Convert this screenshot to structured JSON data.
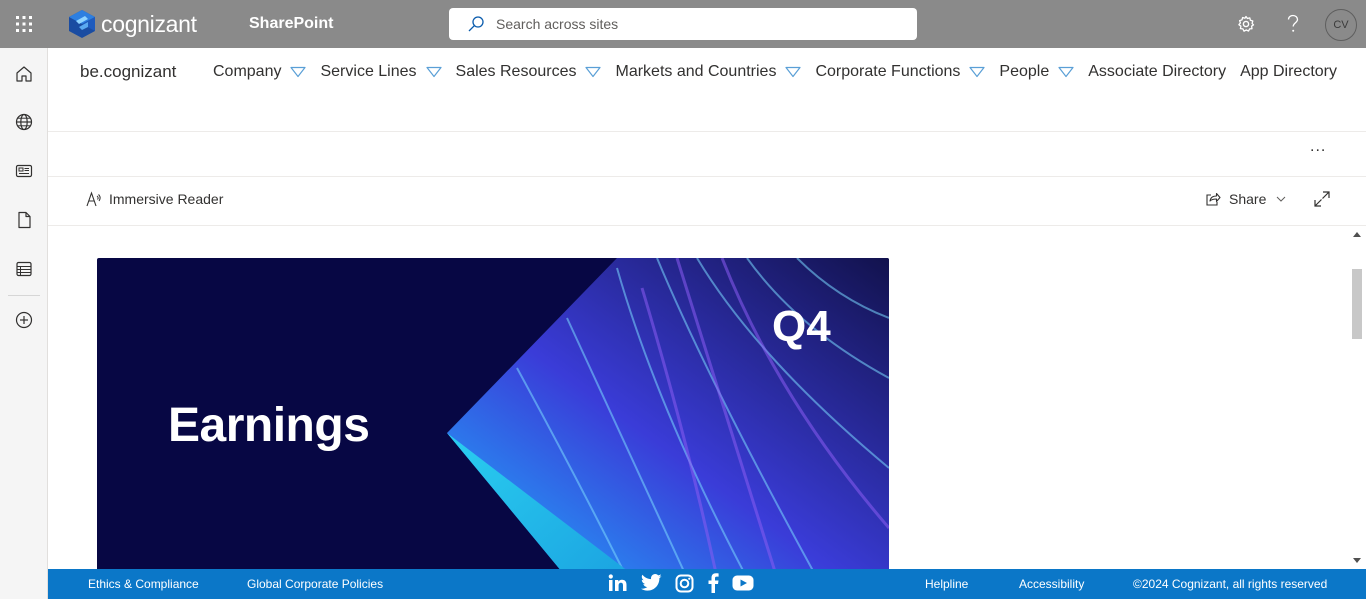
{
  "suite": {
    "brand": "cognizant",
    "app_name": "SharePoint",
    "search_placeholder": "Search across sites",
    "avatar_initials": "CV"
  },
  "site": {
    "title": "be.cognizant",
    "nav": [
      {
        "label": "Company",
        "has_dropdown": true
      },
      {
        "label": "Service Lines",
        "has_dropdown": true
      },
      {
        "label": "Sales Resources",
        "has_dropdown": true
      },
      {
        "label": "Markets and Countries",
        "has_dropdown": true
      },
      {
        "label": "Corporate Functions",
        "has_dropdown": true
      },
      {
        "label": "People",
        "has_dropdown": true
      },
      {
        "label": "Associate Directory",
        "has_dropdown": false
      },
      {
        "label": "App Directory",
        "has_dropdown": false
      }
    ]
  },
  "commandbar": {
    "more": "...",
    "immersive_reader": "Immersive Reader",
    "share": "Share"
  },
  "banner": {
    "title": "Earnings",
    "quarter": "Q4"
  },
  "footer": {
    "ethics": "Ethics & Compliance",
    "policies": "Global Corporate Policies",
    "helpline": "Helpline",
    "accessibility": "Accessibility",
    "copyright": "©2024 Cognizant, all rights reserved",
    "social": [
      "linkedin-icon",
      "twitter-icon",
      "instagram-icon",
      "facebook-icon",
      "youtube-icon"
    ]
  },
  "colors": {
    "suitebar": "#8a8a8a",
    "footer": "#0b77c8",
    "banner_bg": "#070744"
  }
}
